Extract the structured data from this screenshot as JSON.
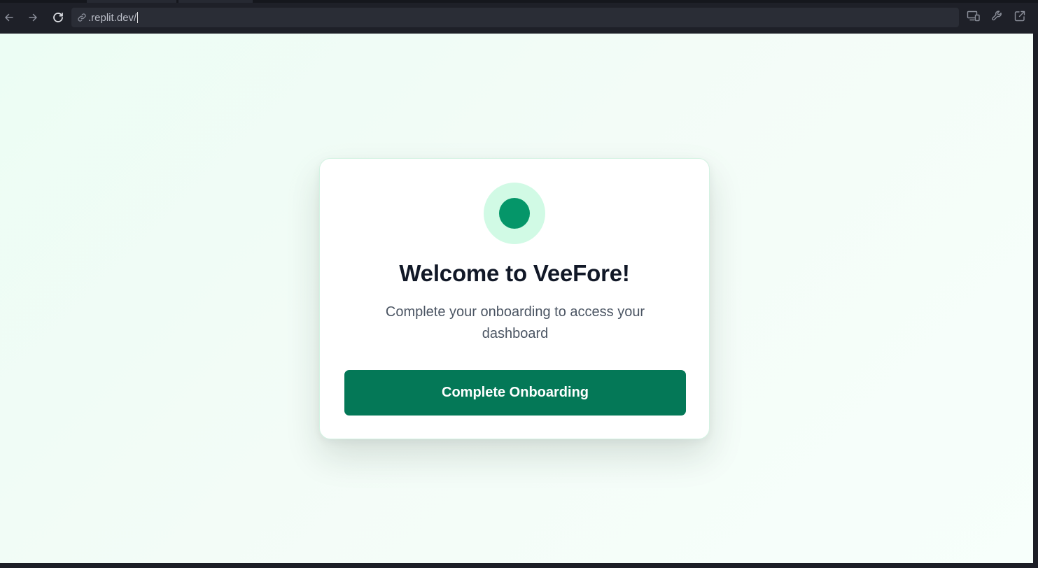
{
  "browser": {
    "url": ".replit.dev/",
    "icons": {
      "back": "arrow-left-icon",
      "forward": "arrow-right-icon",
      "reload": "reload-icon",
      "link": "link-icon",
      "devices": "devices-icon",
      "devtools": "wrench-icon",
      "open_external": "external-link-icon"
    }
  },
  "card": {
    "title": "Welcome to VeeFore!",
    "subtitle": "Complete your onboarding to access your dashboard",
    "button_label": "Complete Onboarding"
  },
  "colors": {
    "accent": "#047857",
    "logo_inner": "#059669",
    "logo_outer": "#d1fae5",
    "title": "#111827",
    "subtitle": "#4b5563"
  }
}
